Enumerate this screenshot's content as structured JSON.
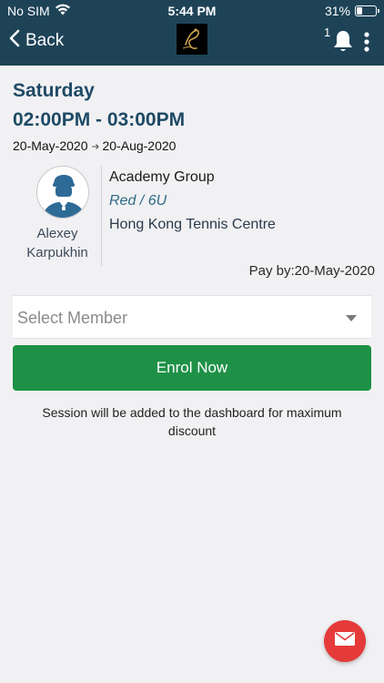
{
  "status_bar": {
    "carrier": "No SIM",
    "time": "5:44 PM",
    "battery": "31%",
    "battery_level": 0.31,
    "wifi_icon": "wifi-icon"
  },
  "nav": {
    "back_label": "Back",
    "notification_count": "1",
    "bell_icon": "bell-icon",
    "menu_icon": "more-vertical-icon",
    "logo_icon": "dancer-logo"
  },
  "session": {
    "day": "Saturday",
    "time_range": "02:00PM - 03:00PM",
    "start_date": "20-May-2020",
    "end_date": "20-Aug-2020",
    "coach": {
      "name": "Alexey Karpukhin"
    },
    "group": "Academy Group",
    "level": "Red / 6U",
    "venue": "Hong Kong Tennis Centre",
    "pay_by": "Pay by:20-May-2020"
  },
  "form": {
    "select_placeholder": "Select Member",
    "enrol_label": "Enrol Now",
    "note": "Session will be added to the dashboard for maximum discount"
  },
  "colors": {
    "header": "#1e4357",
    "title": "#1e4a66",
    "enrol": "#1e9147",
    "fab": "#e53a3a"
  }
}
